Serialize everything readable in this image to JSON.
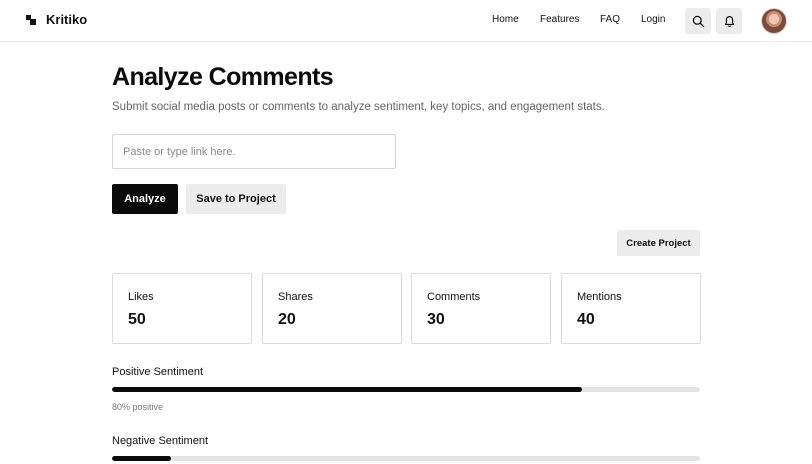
{
  "app": {
    "name": "Kritiko"
  },
  "nav": {
    "links": [
      "Home",
      "Features",
      "FAQ",
      "Login"
    ]
  },
  "icons": {
    "search": "search-icon",
    "notifications": "bell-icon",
    "logo": "kritiko-logo-icon"
  },
  "main": {
    "title": "Analyze Comments",
    "subtitle": "Submit social media posts or comments to analyze sentiment, key topics, and engagement stats.",
    "input": {
      "placeholder": "Paste or type link here.",
      "value": ""
    },
    "analyze_label": "Analyze",
    "save_label": "Save to Project",
    "create_project_label": "Create Project"
  },
  "stats": [
    {
      "label": "Likes",
      "value": "50"
    },
    {
      "label": "Shares",
      "value": "20"
    },
    {
      "label": "Comments",
      "value": "30"
    },
    {
      "label": "Mentions",
      "value": "40"
    }
  ],
  "sentiment": {
    "positive": {
      "title": "Positive Sentiment",
      "level": 0.8,
      "caption": "80% positive"
    },
    "negative": {
      "title": "Negative Sentiment",
      "level": 0.1
    }
  },
  "colors": {
    "primary": "#0a0a0a",
    "secondary_button": "#ececec",
    "track": "#e3e3e3"
  }
}
